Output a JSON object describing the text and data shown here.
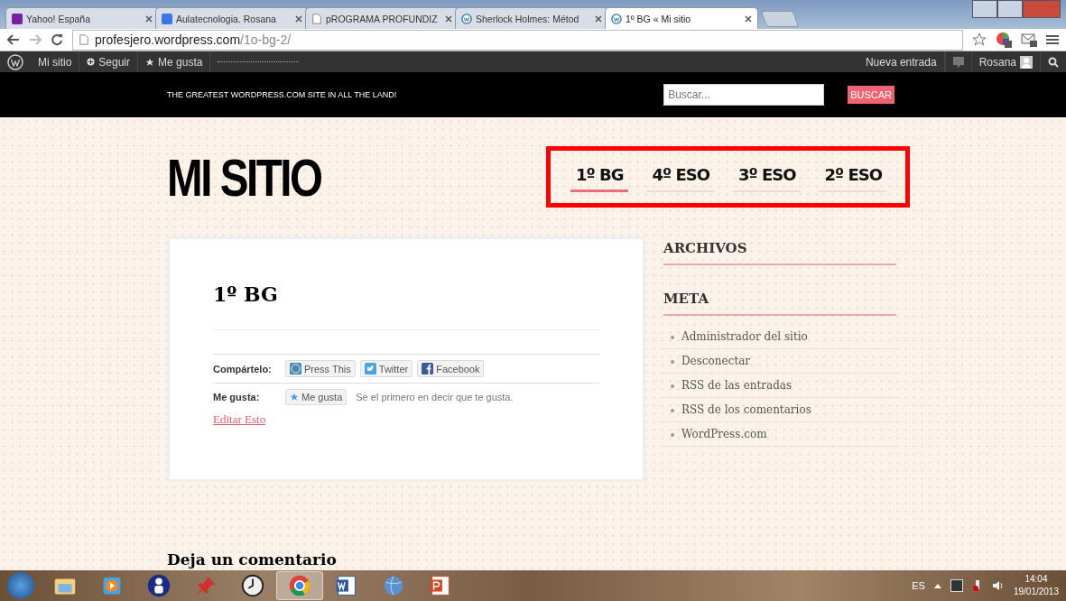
{
  "browser": {
    "tabs": [
      {
        "title": "Yahoo! España",
        "selected": false
      },
      {
        "title": "Aulatecnologia. Rosana",
        "selected": false
      },
      {
        "title": "pROGRAMA PROFUNDIZ",
        "selected": false
      },
      {
        "title": "Sherlock Holmes: Métod",
        "selected": false
      },
      {
        "title": "1º BG « Mi sitio",
        "selected": true
      }
    ],
    "url_host": "profesjero.wordpress.com",
    "url_path": "/1o-bg-2/"
  },
  "admin_bar": {
    "left": [
      "Mi sitio",
      "Seguir",
      "Me gusta"
    ],
    "new_post": "Nueva entrada",
    "user": "Rosana"
  },
  "header": {
    "tagline": "THE GREATEST WORDPRESS.COM SITE IN ALL THE LAND!",
    "search_placeholder": "Buscar...",
    "search_button": "BUSCAR"
  },
  "site_title": "MI SITIO",
  "nav": [
    {
      "label": "1º BG",
      "selected": true
    },
    {
      "label": "4º ESO",
      "selected": false
    },
    {
      "label": "3º ESO",
      "selected": false
    },
    {
      "label": "2º ESO",
      "selected": false
    }
  ],
  "post": {
    "title": "1º BG",
    "share_label": "Compártelo:",
    "share_buttons": [
      "Press This",
      "Twitter",
      "Facebook"
    ],
    "like_label": "Me gusta:",
    "like_button": "Me gusta",
    "like_text": "Se el primero en decir que te gusta.",
    "edit_link": "Editar Esto"
  },
  "sidebar": [
    {
      "heading": "ARCHIVOS"
    },
    {
      "heading": "META",
      "items": [
        "Administrador del sitio",
        "Desconectar",
        "RSS de las entradas",
        "RSS de los comentarios",
        "WordPress.com"
      ]
    }
  ],
  "comments_heading": "Deja un comentario",
  "taskbar": {
    "apps": [
      {
        "active": false
      },
      {
        "active": false
      },
      {
        "active": false
      },
      {
        "active": false
      },
      {
        "active": false
      },
      {
        "active": true
      },
      {
        "active": false
      },
      {
        "active": false
      },
      {
        "active": false
      }
    ],
    "language": "ES",
    "time": "14:04",
    "date": "19/01/2013"
  }
}
